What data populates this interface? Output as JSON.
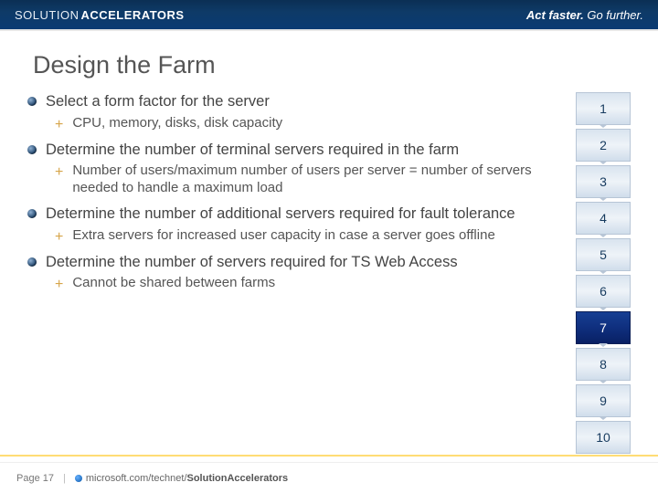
{
  "brand": {
    "thin": "SOLUTION",
    "bold": "ACCELERATORS"
  },
  "tagline": {
    "a": "Act faster.",
    "b": "Go further."
  },
  "title": "Design the Farm",
  "bullets": [
    {
      "text": "Select a form factor for the server",
      "sub": [
        "CPU, memory, disks, disk capacity"
      ]
    },
    {
      "text": "Determine the number of terminal servers required in the farm",
      "sub": [
        "Number of users/maximum number of users per server = number of servers needed to handle a maximum load"
      ]
    },
    {
      "text": "Determine the number of additional servers required for fault tolerance",
      "sub": [
        "Extra servers for increased user capacity in case a server goes offline"
      ]
    },
    {
      "text": "Determine the number of servers required for TS Web Access",
      "sub": [
        "Cannot be shared between farms"
      ]
    }
  ],
  "steps": {
    "count": 10,
    "active": 7
  },
  "footer": {
    "page": "Page 17",
    "sep": "|",
    "link": {
      "a": "microsoft.com/technet/",
      "b": "SolutionAccelerators"
    }
  }
}
